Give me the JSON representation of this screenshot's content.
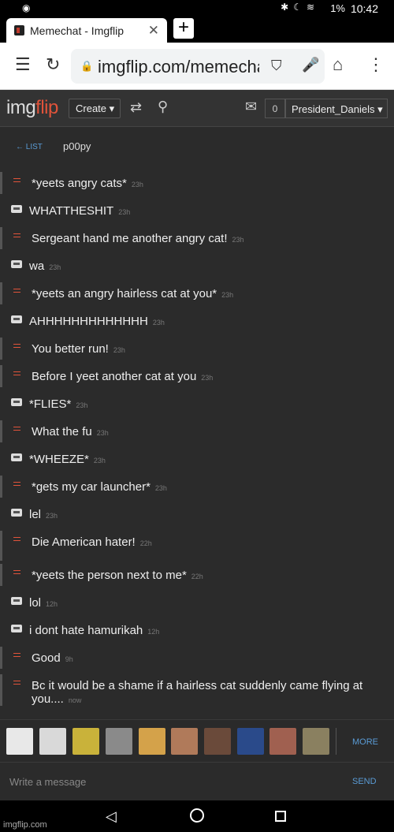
{
  "status_bar": {
    "battery": "1%",
    "time": "10:42",
    "icons": [
      "bluetooth-icon",
      "moon-icon",
      "wifi-icon",
      "battery-icon"
    ]
  },
  "browser": {
    "tab_title": "Memechat - Imgflip",
    "url": "imgflip.com/memechat",
    "icons": [
      "menu-icon",
      "reload-icon",
      "lock-icon",
      "bookmark-icon",
      "mic-icon",
      "home-icon",
      "more-vert-icon"
    ]
  },
  "header": {
    "logo_part1": "img",
    "logo_part2": "flip",
    "create_label": "Create ▾",
    "notif_count": "0",
    "username": "President_Daniels ▾"
  },
  "chat": {
    "back_label": "← LIST",
    "room_name": "p00py",
    "messages": [
      {
        "side": "mine",
        "text": "*yeets angry cats*",
        "time": "23h"
      },
      {
        "side": "other",
        "text": "WHATTHESHIT",
        "time": "23h"
      },
      {
        "side": "mine",
        "text": "Sergeant hand me another angry cat!",
        "time": "23h"
      },
      {
        "side": "other",
        "text": "wa",
        "time": "23h"
      },
      {
        "side": "mine",
        "text": "*yeets an angry hairless cat at you*",
        "time": "23h"
      },
      {
        "side": "other",
        "text": "AHHHHHHHHHHHHH",
        "time": "23h"
      },
      {
        "side": "mine",
        "text": "You better run!",
        "time": "23h"
      },
      {
        "side": "mine",
        "text": "Before I yeet another cat at you",
        "time": "23h"
      },
      {
        "side": "other",
        "text": "*FLIES*",
        "time": "23h"
      },
      {
        "side": "mine",
        "text": "What the fu",
        "time": "23h"
      },
      {
        "side": "other",
        "text": "*WHEEZE*",
        "time": "23h"
      },
      {
        "side": "mine",
        "text": "*gets my car launcher*",
        "time": "23h"
      },
      {
        "side": "other",
        "text": "lel",
        "time": "23h"
      },
      {
        "side": "mine",
        "text": "Die American hater!",
        "time": "22h"
      },
      {
        "side": "mine",
        "text": "*yeets the person next to me*",
        "time": "22h"
      },
      {
        "side": "other",
        "text": "lol",
        "time": "12h"
      },
      {
        "side": "other",
        "text": "i dont hate hamurikah",
        "time": "12h"
      },
      {
        "side": "mine",
        "text": "Good",
        "time": "9h"
      },
      {
        "side": "mine",
        "text": "Bc it would be a shame if a hairless cat suddenly came flying at you....",
        "time": "now"
      }
    ]
  },
  "meme_strip": {
    "more_label": "MORE",
    "thumbs": [
      "#e8e8e8",
      "#d9d9d9",
      "#c9b23a",
      "#8a8a8a",
      "#d4a24a",
      "#b07a5a",
      "#6a4a3a",
      "#2a4a8a",
      "#a06050",
      "#8a8060"
    ]
  },
  "composer": {
    "placeholder": "Write a message",
    "send_label": "SEND"
  },
  "watermark": "imgflip.com"
}
